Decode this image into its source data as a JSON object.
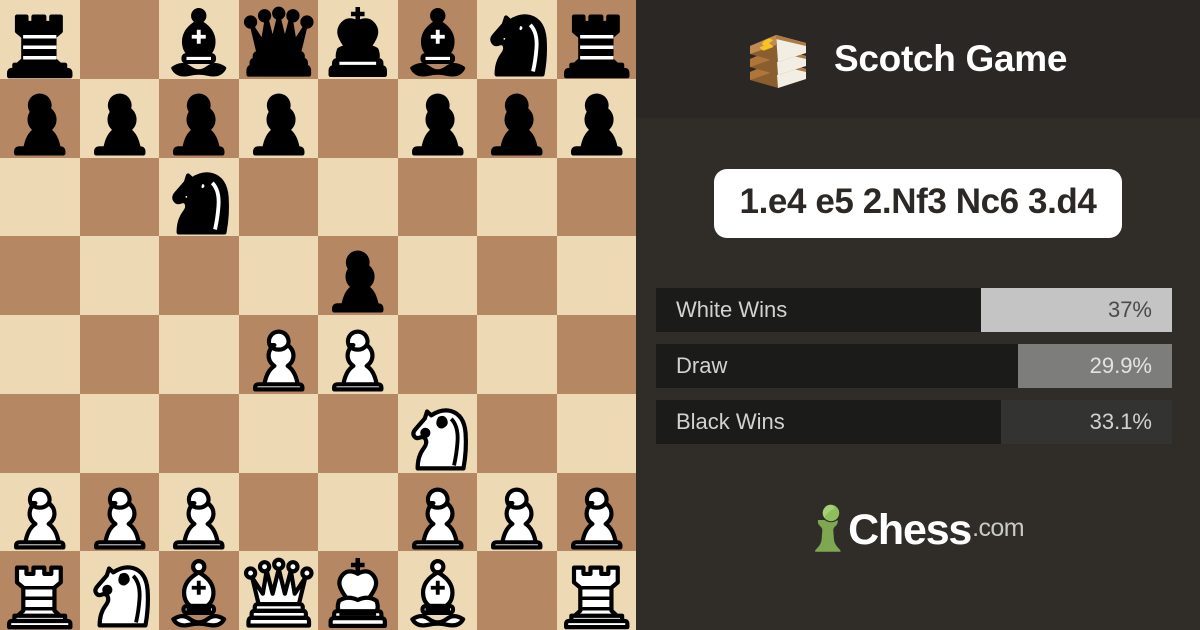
{
  "header": {
    "icon": "book-stack-icon",
    "title": "Scotch Game"
  },
  "moves": {
    "text": "1.e4 e5 2.Nf3 Nc6 3.d4"
  },
  "stats": {
    "rows": [
      {
        "label": "White Wins",
        "value": "37%",
        "percent": 37.0
      },
      {
        "label": "Draw",
        "value": "29.9%",
        "percent": 29.9
      },
      {
        "label": "Black Wins",
        "value": "33.1%",
        "percent": 33.1
      }
    ]
  },
  "brand": {
    "icon": "chess-pawn-icon",
    "name": "Chess",
    "tld": ".com"
  },
  "colors": {
    "panel_bg": "#302D29",
    "panel_header_bg": "#2A2724",
    "board_light": "#EDDAB4",
    "board_dark": "#B58863",
    "bar_track": "#1B1B19",
    "white_fill": "#C4C4C4",
    "draw_fill": "#7D7D7B",
    "black_fill": "#333331",
    "brand_green": "#7FA650",
    "chip_bg": "#FFFFFF",
    "book_tan": "#C08B4E",
    "book_accent": "#F5C324"
  },
  "board": {
    "orientation": "white-bottom",
    "fen": "r1bqkbnr/pppp1ppp/2n5/4p3/3PP3/5N2/PPP2PPP/RNBQKB1R",
    "ranks": [
      [
        "br",
        "",
        "bb",
        "bq",
        "bk",
        "bb",
        "bn",
        "br"
      ],
      [
        "bp",
        "bp",
        "bp",
        "bp",
        "",
        "bp",
        "bp",
        "bp"
      ],
      [
        "",
        "",
        "bn",
        "",
        "",
        "",
        "",
        ""
      ],
      [
        "",
        "",
        "",
        "",
        "bp",
        "",
        "",
        ""
      ],
      [
        "",
        "",
        "",
        "wp",
        "wp",
        "",
        "",
        ""
      ],
      [
        "",
        "",
        "",
        "",
        "",
        "wn",
        "",
        ""
      ],
      [
        "wp",
        "wp",
        "wp",
        "",
        "",
        "wp",
        "wp",
        "wp"
      ],
      [
        "wr",
        "wn",
        "wb",
        "wq",
        "wk",
        "wb",
        "",
        "wr"
      ]
    ]
  }
}
